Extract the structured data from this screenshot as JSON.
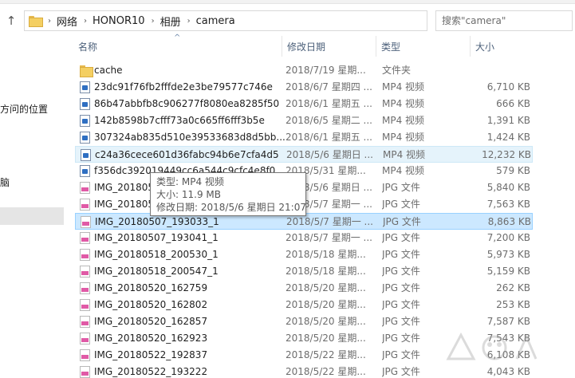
{
  "address": {
    "crumbs": [
      "网络",
      "HONOR10",
      "相册",
      "camera"
    ],
    "search_placeholder": "搜索\"camera\""
  },
  "nav": {
    "items": [
      "方问的位置",
      "脑"
    ]
  },
  "columns": {
    "name": "名称",
    "date": "修改日期",
    "type": "类型",
    "size": "大小"
  },
  "files": [
    {
      "name": "cache",
      "date": "2018/7/19 星期...",
      "type": "文件夹",
      "size": "",
      "icon": "folder-icon"
    },
    {
      "name": "23dc91f76fb2fffde2e3be79577c746e",
      "date": "2018/6/7 星期四 ...",
      "type": "MP4 视频",
      "size": "6,710 KB",
      "icon": "video-file-icon"
    },
    {
      "name": "86b47abbfb8c906277f8080ea8285f50",
      "date": "2018/6/1 星期五 ...",
      "type": "MP4 视频",
      "size": "666 KB",
      "icon": "video-file-icon"
    },
    {
      "name": "142b8598b7cfff73a0c665ff6fff3b5e",
      "date": "2018/6/5 星期二 ...",
      "type": "MP4 视频",
      "size": "1,391 KB",
      "icon": "video-file-icon"
    },
    {
      "name": "307324ab835d510e39533683d8d5bb...",
      "date": "2018/6/1 星期五 ...",
      "type": "MP4 视频",
      "size": "1,424 KB",
      "icon": "video-file-icon"
    },
    {
      "name": "c24a36cece601d36fabc94b6e7cfa4d5",
      "date": "2018/5/6 星期日 ...",
      "type": "MP4 视频",
      "size": "12,232 KB",
      "icon": "video-file-icon"
    },
    {
      "name": "f356dc392019449cc6a544c9cfc4e8f0",
      "date": "2018/5/31 星期...",
      "type": "MP4 视频",
      "size": "579 KB",
      "icon": "video-file-icon"
    },
    {
      "name": "IMG_20180505",
      "date": "2018/5/6 星期日 ...",
      "type": "JPG 文件",
      "size": "5,840 KB",
      "icon": "image-file-icon"
    },
    {
      "name": "IMG_20180505",
      "date": "2018/5/7 星期一 ...",
      "type": "JPG 文件",
      "size": "7,563 KB",
      "icon": "image-file-icon"
    },
    {
      "name": "IMG_20180507_193033_1",
      "date": "2018/5/7 星期一 ...",
      "type": "JPG 文件",
      "size": "8,863 KB",
      "icon": "image-file-icon"
    },
    {
      "name": "IMG_20180507_193041_1",
      "date": "2018/5/7 星期一 ...",
      "type": "JPG 文件",
      "size": "7,200 KB",
      "icon": "image-file-icon"
    },
    {
      "name": "IMG_20180518_200530_1",
      "date": "2018/5/18 星期...",
      "type": "JPG 文件",
      "size": "5,973 KB",
      "icon": "image-file-icon"
    },
    {
      "name": "IMG_20180518_200547_1",
      "date": "2018/5/18 星期...",
      "type": "JPG 文件",
      "size": "5,159 KB",
      "icon": "image-file-icon"
    },
    {
      "name": "IMG_20180520_162759",
      "date": "2018/5/20 星期...",
      "type": "JPG 文件",
      "size": "262 KB",
      "icon": "image-file-icon"
    },
    {
      "name": "IMG_20180520_162802",
      "date": "2018/5/20 星期...",
      "type": "JPG 文件",
      "size": "253 KB",
      "icon": "image-file-icon"
    },
    {
      "name": "IMG_20180520_162857",
      "date": "2018/5/20 星期...",
      "type": "JPG 文件",
      "size": "7,587 KB",
      "icon": "image-file-icon"
    },
    {
      "name": "IMG_20180520_162923",
      "date": "2018/5/20 星期...",
      "type": "JPG 文件",
      "size": "7,543 KB",
      "icon": "image-file-icon"
    },
    {
      "name": "IMG_20180522_192837",
      "date": "2018/5/22 星期...",
      "type": "JPG 文件",
      "size": "6,108 KB",
      "icon": "image-file-icon"
    },
    {
      "name": "IMG_20180522_193222",
      "date": "2018/5/22 星期...",
      "type": "JPG 文件",
      "size": "4,043 KB",
      "icon": "image-file-icon"
    }
  ],
  "hover_row": 5,
  "selected_row": 9,
  "tooltip": {
    "type_line": "类型: MP4 视频",
    "size_line": "大小: 11.9 MB",
    "date_line": "修改日期: 2018/5/6 星期日 21:07"
  },
  "colors": {
    "hover_bg": "#e5f3fb",
    "selected_bg": "#cce8ff",
    "header_text": "#4c607a"
  }
}
